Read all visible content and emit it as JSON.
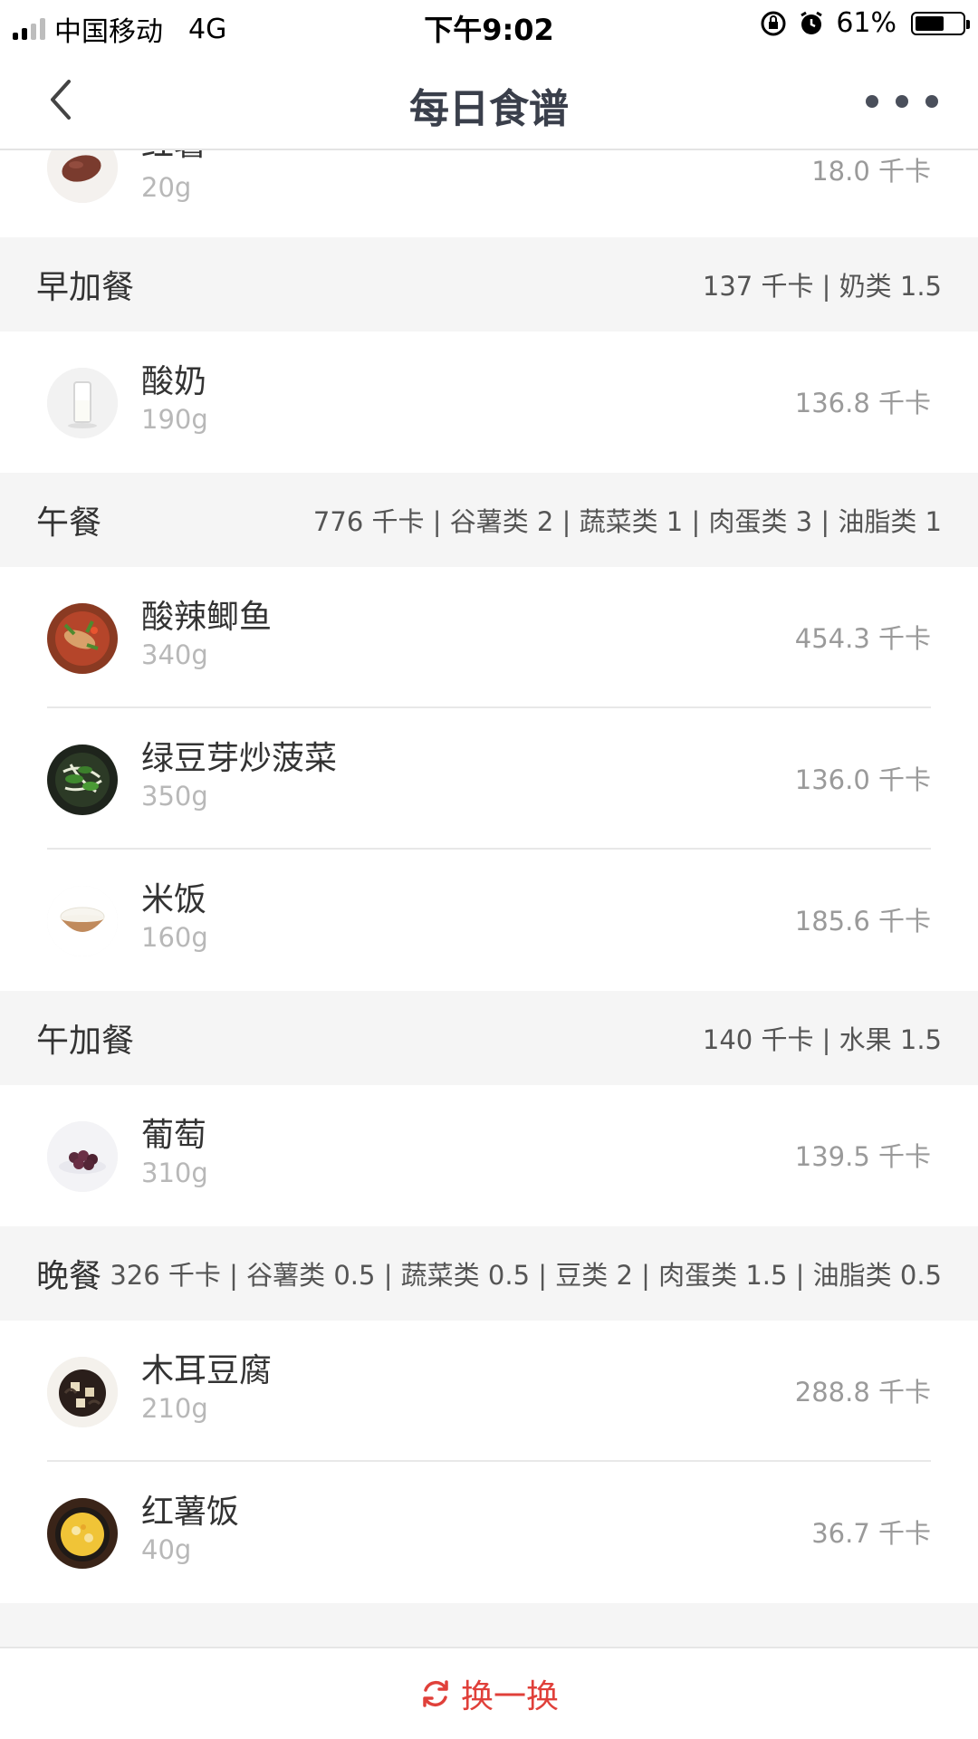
{
  "status_bar": {
    "carrier": "中国移动",
    "network": "4G",
    "time": "下午9:02",
    "battery": "61%",
    "battery_level": 0.61
  },
  "nav": {
    "title": "每日食谱"
  },
  "partial_item": {
    "name": "红薯",
    "weight": "20g",
    "kcal": "18.0 千卡"
  },
  "sections": [
    {
      "name": "早加餐",
      "summary": "137 千卡 | 奶类 1.5",
      "items": [
        {
          "name": "酸奶",
          "weight": "190g",
          "kcal": "136.8 千卡"
        }
      ]
    },
    {
      "name": "午餐",
      "summary": "776 千卡 | 谷薯类 2 | 蔬菜类 1 | 肉蛋类 3 | 油脂类 1",
      "items": [
        {
          "name": "酸辣鲫鱼",
          "weight": "340g",
          "kcal": "454.3 千卡"
        },
        {
          "name": "绿豆芽炒菠菜",
          "weight": "350g",
          "kcal": "136.0 千卡"
        },
        {
          "name": "米饭",
          "weight": "160g",
          "kcal": "185.6 千卡"
        }
      ]
    },
    {
      "name": "午加餐",
      "summary": "140 千卡 | 水果 1.5",
      "items": [
        {
          "name": "葡萄",
          "weight": "310g",
          "kcal": "139.5 千卡"
        }
      ]
    },
    {
      "name": "晚餐",
      "summary": "326 千卡 | 谷薯类 0.5 | 蔬菜类 0.5 | 豆类 2 | 肉蛋类 1.5 | 油脂类 0.5",
      "items": [
        {
          "name": "木耳豆腐",
          "weight": "210g",
          "kcal": "288.8 千卡"
        },
        {
          "name": "红薯饭",
          "weight": "40g",
          "kcal": "36.7 千卡"
        }
      ]
    }
  ],
  "bottom": {
    "refresh_label": "换一换"
  }
}
